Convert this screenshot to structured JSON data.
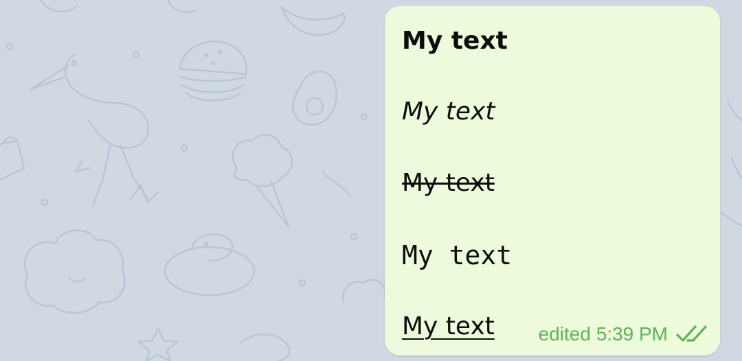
{
  "chat": {
    "background_color": "#d0d9e2",
    "message": {
      "bubble_color": "#edfadb",
      "lines": {
        "bold": "My text",
        "italic": "My text",
        "strikethrough": "My text",
        "monospace": "My text",
        "underline": "My text"
      },
      "status": {
        "time_label": "edited 5:39 PM",
        "read_icon": "double-check-icon",
        "status_color": "#5fb258"
      }
    }
  }
}
